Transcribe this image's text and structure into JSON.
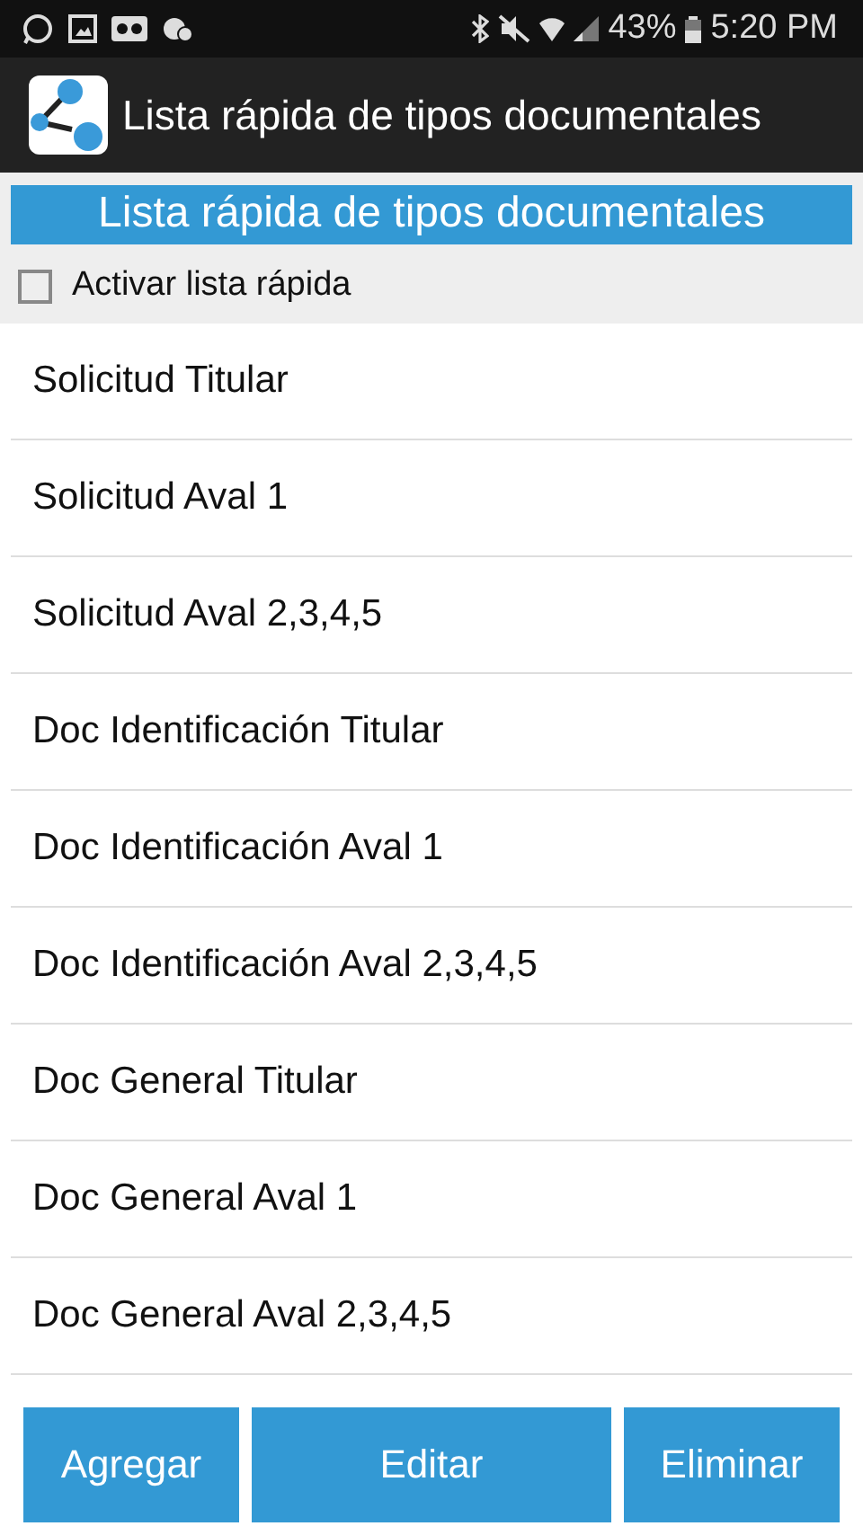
{
  "status_bar": {
    "battery": "43%",
    "time": "5:20 PM"
  },
  "app_bar": {
    "title": "Lista rápida de tipos documentales"
  },
  "header": "Lista rápida de tipos documentales",
  "quick_list_toggle": {
    "label": "Activar lista rápida",
    "checked": false
  },
  "items": [
    "Solicitud Titular",
    "Solicitud Aval 1",
    "Solicitud Aval 2,3,4,5",
    "Doc Identificación Titular",
    "Doc Identificación Aval 1",
    "Doc Identificación Aval 2,3,4,5",
    "Doc General Titular",
    "Doc General Aval 1",
    "Doc General Aval 2,3,4,5"
  ],
  "buttons": [
    "Agregar",
    "Editar",
    "Eliminar"
  ]
}
